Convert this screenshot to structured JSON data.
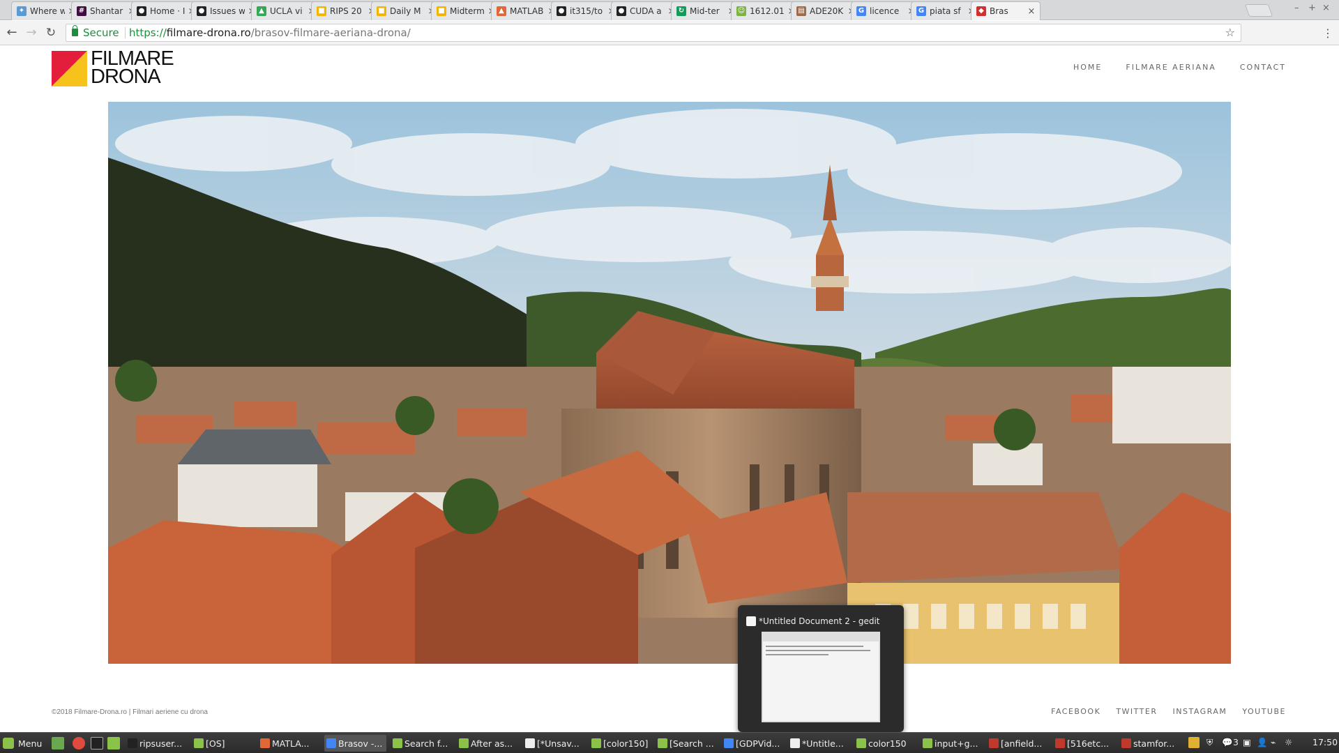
{
  "browser": {
    "tabs": [
      {
        "label": "Where w",
        "color": "#5b9bd5",
        "glyph": "✦"
      },
      {
        "label": "Shantar",
        "color": "#3f0f3f",
        "glyph": "#"
      },
      {
        "label": "Home · I",
        "color": "#222222",
        "glyph": "●"
      },
      {
        "label": "Issues w",
        "color": "#222222",
        "glyph": "●"
      },
      {
        "label": "UCLA vi",
        "color": "#34a853",
        "glyph": "▲"
      },
      {
        "label": "RIPS 20",
        "color": "#f4b400",
        "glyph": "■"
      },
      {
        "label": "Daily M",
        "color": "#f4b400",
        "glyph": "■"
      },
      {
        "label": "Midterm",
        "color": "#f4b400",
        "glyph": "■"
      },
      {
        "label": "MATLAB",
        "color": "#e16737",
        "glyph": "▲"
      },
      {
        "label": "it315/to",
        "color": "#222222",
        "glyph": "●"
      },
      {
        "label": "CUDA a",
        "color": "#222222",
        "glyph": "●"
      },
      {
        "label": "Mid-ter",
        "color": "#0f9d58",
        "glyph": "↻"
      },
      {
        "label": "1612.01",
        "color": "#7cb342",
        "glyph": "☺"
      },
      {
        "label": "ADE20K",
        "color": "#9e6b4a",
        "glyph": "▤"
      },
      {
        "label": "licence",
        "color": "#4285f4",
        "glyph": "G"
      },
      {
        "label": "piata sf",
        "color": "#4285f4",
        "glyph": "G"
      },
      {
        "label": "Bras",
        "color": "#d32f2f",
        "glyph": "◆",
        "active": true
      }
    ],
    "secure_label": "Secure",
    "url_scheme": "https://",
    "url_host": "filmare-drona.ro",
    "url_path": "/brasov-filmare-aeriana-drona/"
  },
  "site": {
    "logo_line1": "FILMARE",
    "logo_line2": "DRONA",
    "nav": [
      "HOME",
      "FILMARE AERIANA",
      "CONTACT"
    ],
    "hero_alt": "Aerial view of Brasov and the Black Church",
    "footer_copy": "©2018 Filmare-Drona.ro | Filmari aeriene cu drona",
    "social": [
      "FACEBOOK",
      "TWITTER",
      "INSTAGRAM",
      "YOUTUBE"
    ]
  },
  "preview": {
    "title": "*Untitled Document 2 - gedit"
  },
  "taskbar": {
    "menu_label": "Menu",
    "tasks": [
      {
        "label": "ripsuser...",
        "color": "#222"
      },
      {
        "label": "[OS]",
        "color": "#8bc34a"
      },
      {
        "label": "MATLA...",
        "color": "#e16737"
      },
      {
        "label": "Brasov -...",
        "color": "#4285f4",
        "active": true
      },
      {
        "label": "Search f...",
        "color": "#8bc34a"
      },
      {
        "label": "After as...",
        "color": "#8bc34a"
      },
      {
        "label": "[*Unsav...",
        "color": "#eeeeee"
      },
      {
        "label": "[color150]",
        "color": "#8bc34a"
      },
      {
        "label": "[Search ...",
        "color": "#8bc34a"
      },
      {
        "label": "[GDPVid...",
        "color": "#4285f4"
      },
      {
        "label": "*Untitle...",
        "color": "#eeeeee"
      },
      {
        "label": "color150",
        "color": "#8bc34a"
      },
      {
        "label": "input+g...",
        "color": "#8bc34a"
      },
      {
        "label": "[anfield...",
        "color": "#c0392b"
      },
      {
        "label": "[516etc...",
        "color": "#c0392b"
      },
      {
        "label": "stamfor...",
        "color": "#c0392b"
      }
    ],
    "tray_count": "3",
    "clock": "17:50"
  }
}
